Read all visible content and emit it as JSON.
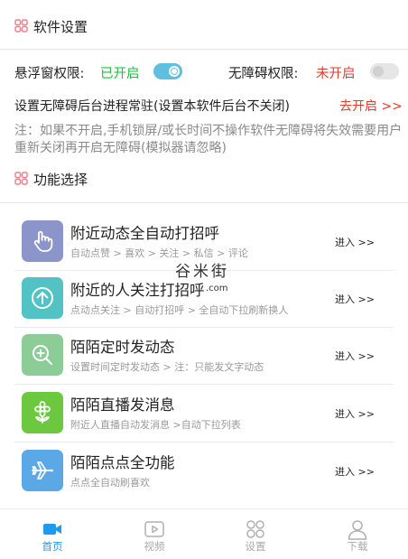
{
  "software_settings": {
    "title": "软件设置"
  },
  "floating_window": {
    "label": "悬浮窗权限:",
    "status": "已开启",
    "status_color": "#1dbf3b",
    "toggle_on": true
  },
  "accessibility": {
    "label": "无障碍权限:",
    "status": "未开启",
    "status_color": "#e53b2c",
    "toggle_on": false
  },
  "background_service": {
    "text": "设置无障碍后台进程常驻(设置本软件后台不关闭)",
    "link": "去开启 >>"
  },
  "note": "注：如果不开启,手机锁屏/或长时间不操作软件无障碍将失效需要用户重新关闭再开启无障碍(模拟器请忽略)",
  "function_select": {
    "title": "功能选择"
  },
  "features": [
    {
      "title": "附近动态全自动打招呼",
      "subtitle": "自动点赞 > 喜欢 > 关注 > 私信 > 评论",
      "enter": "进入 >>",
      "icon": "hand-pointer-icon",
      "color": "#8b95c9"
    },
    {
      "title": "附近的人关注打招呼",
      "subtitle": "点动点关注 > 自动打招呼 > 全自动下拉刷新换人",
      "enter": "进入 >>",
      "icon": "arrow-up-icon",
      "color": "#52c2c4"
    },
    {
      "title": "陌陌定时发动态",
      "subtitle": "设置时间定时发动态 > 注：只能发文字动态",
      "enter": "进入 >>",
      "icon": "magnifier-plus-icon",
      "color": "#8ccc97"
    },
    {
      "title": "陌陌直播发消息",
      "subtitle": "附近人直播自动发消息 >自动下拉列表",
      "enter": "进入 >>",
      "icon": "flower-icon",
      "color": "#6cc93f"
    },
    {
      "title": "陌陌点点全功能",
      "subtitle": "点点全自动刷喜欢",
      "enter": "进入 >>",
      "icon": "airplane-icon",
      "color": "#5ba8e6"
    }
  ],
  "watermark": {
    "name": "谷米街",
    "suffix": ".com"
  },
  "bottom_nav": [
    {
      "label": "首页",
      "icon": "video-camera-icon",
      "active": true
    },
    {
      "label": "视频",
      "icon": "play-icon",
      "active": false
    },
    {
      "label": "设置",
      "icon": "four-circles-icon",
      "active": false
    },
    {
      "label": "下载",
      "icon": "user-icon",
      "active": false
    }
  ],
  "colors": {
    "accent": "#1e9bf0",
    "toggle_on": "#5fbfe0",
    "toggle_off": "#e6e6e6"
  }
}
